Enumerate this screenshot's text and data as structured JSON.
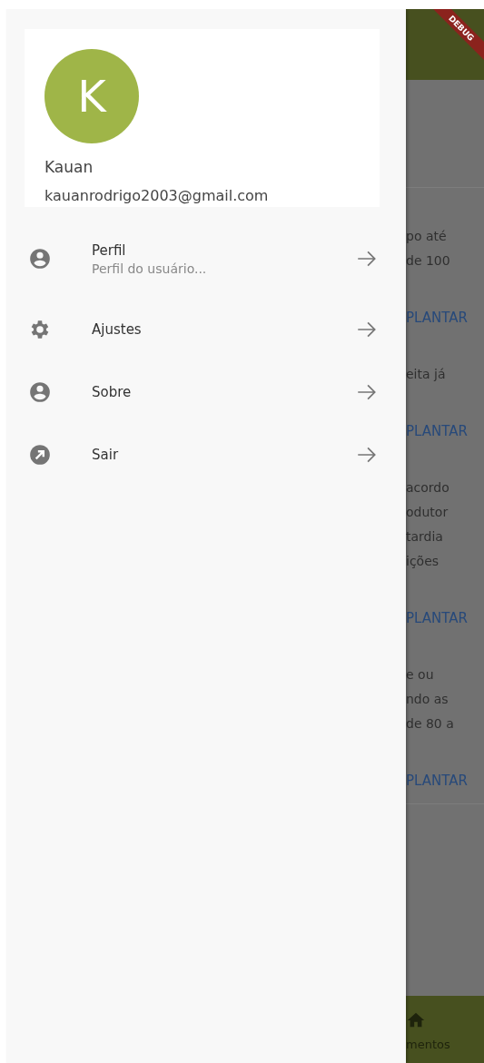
{
  "drawer": {
    "header": {
      "avatar_letter": "K",
      "name": "Kauan",
      "email": "kauanrodrigo2003@gmail.com"
    },
    "items": [
      {
        "kind": "person",
        "title": "Perfil",
        "subtitle": "Perfil do usuário..."
      },
      {
        "kind": "gear",
        "title": "Ajustes"
      },
      {
        "kind": "person",
        "title": "Sobre"
      },
      {
        "kind": "exit",
        "title": "Sair"
      }
    ]
  },
  "background": {
    "banner": "DEBUG",
    "cards": [
      {
        "lines": [
          "po até",
          "de 100"
        ],
        "action": "PLANTAR"
      },
      {
        "lines": [
          "eita já"
        ],
        "action": "PLANTAR"
      },
      {
        "lines": [
          "acordo",
          "odutor",
          "tardia",
          "ições"
        ],
        "action": "PLANTAR"
      },
      {
        "lines": [
          "e ou",
          "ndo as",
          "de 80 a"
        ],
        "action": "PLANTAR"
      }
    ],
    "nav_label": "mentos"
  }
}
